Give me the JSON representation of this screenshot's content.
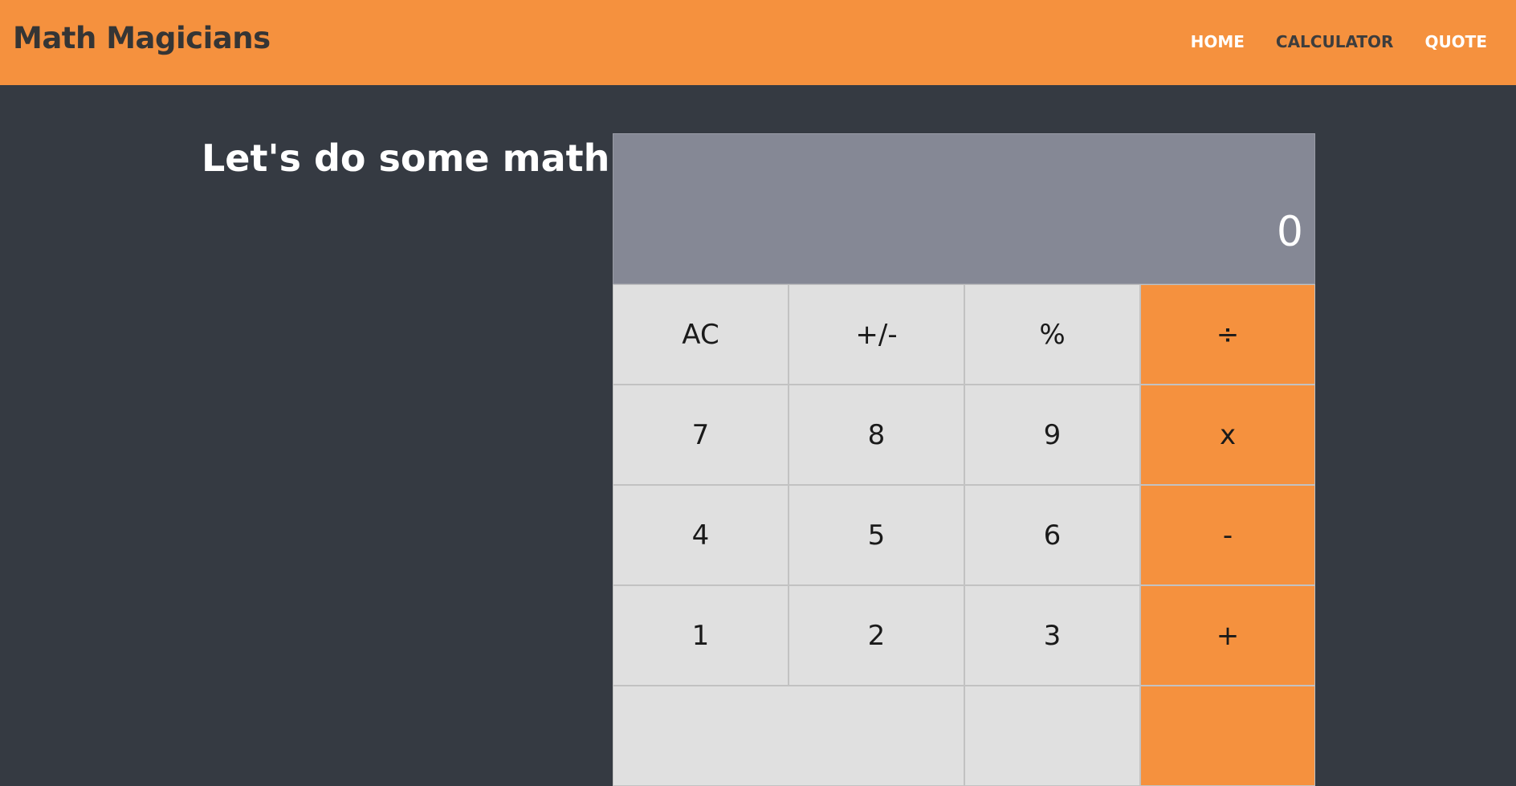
{
  "app": {
    "logo": "Math Magicians"
  },
  "nav": {
    "items": [
      {
        "label": "HOME"
      },
      {
        "label": "CALCULATOR"
      },
      {
        "label": "QUOTE"
      }
    ]
  },
  "main": {
    "heading": "Let's do some math!"
  },
  "calculator": {
    "display": "0",
    "keys": {
      "ac": "AC",
      "sign": "+/-",
      "percent": "%",
      "divide": "÷",
      "seven": "7",
      "eight": "8",
      "nine": "9",
      "multiply": "x",
      "four": "4",
      "five": "5",
      "six": "6",
      "minus": "-",
      "one": "1",
      "two": "2",
      "three": "3",
      "plus": "+"
    }
  },
  "colors": {
    "navbar": "#f5913e",
    "background": "#353a42",
    "display": "#858895",
    "key": "#e0e0e0",
    "operator": "#f5913e"
  }
}
